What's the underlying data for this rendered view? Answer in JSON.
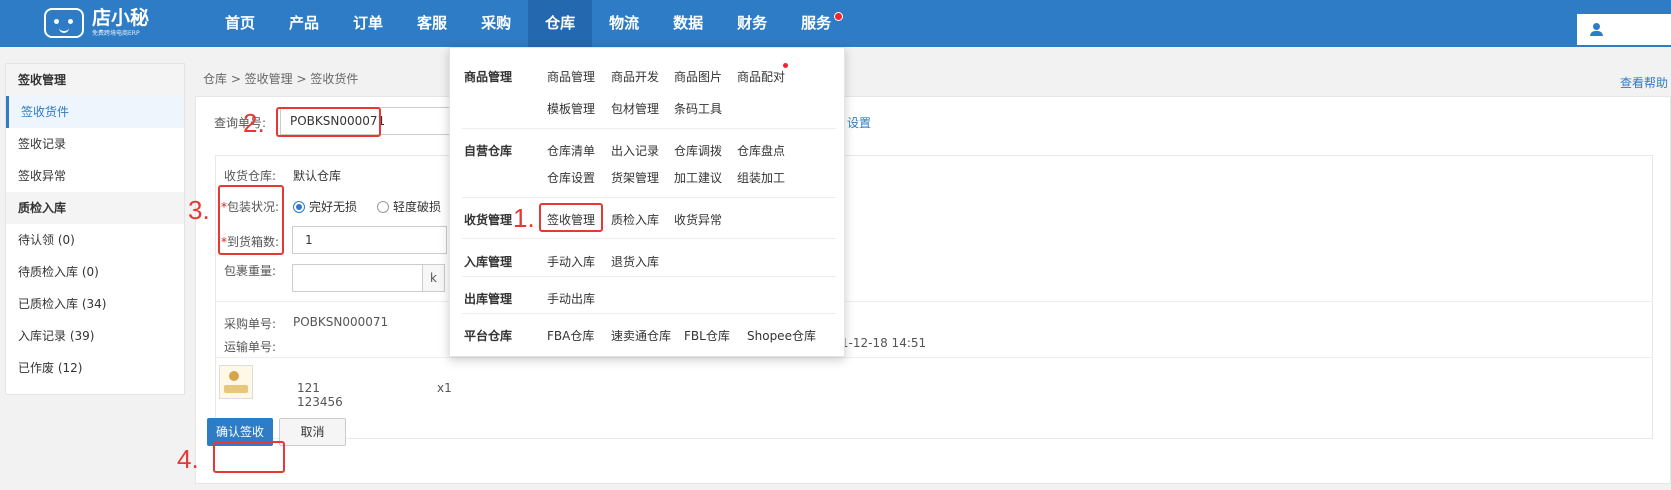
{
  "topbar": {
    "logo_name": "店小秘",
    "logo_sub": "免费跨境电商ERP",
    "nav": [
      "首页",
      "产品",
      "订单",
      "客服",
      "采购",
      "仓库",
      "物流",
      "数据",
      "财务",
      "服务"
    ],
    "active_nav": "仓库"
  },
  "sidebar": {
    "group1": "签收管理",
    "items1": [
      "签收货件",
      "签收记录",
      "签收异常"
    ],
    "group2": "质检入库",
    "items2": [
      "待认领 (0)",
      "待质检入库 (0)",
      "已质检入库 (34)",
      "入库记录 (39)",
      "已作废 (12)"
    ]
  },
  "breadcrumb": "仓库 > 签收管理 > 签收货件",
  "help_link": "查看帮助",
  "form": {
    "query_label": "查询单号:",
    "query_value": "POBKSN000071",
    "settings_link": "设置",
    "warehouse_label": "收货仓库:",
    "warehouse_value": "默认仓库",
    "package_label": "包装状况:",
    "package_opt1": "完好无损",
    "package_opt2": "轻度破损",
    "box_count_label": "到货箱数:",
    "box_count_value": "1",
    "weight_label": "包裹重量:",
    "weight_unit": "k",
    "po_label": "采购单号:",
    "po_value": "POBKSN000071",
    "shipping_label": "运输单号:",
    "datetime": "2021-12-18 14:51",
    "product_name": "121",
    "product_sku": "123456",
    "product_qty": "x1",
    "confirm_btn": "确认签收",
    "cancel_btn": "取消"
  },
  "dropdown": {
    "sections": [
      {
        "title": "商品管理",
        "rows": [
          [
            "商品管理",
            "商品开发",
            "商品图片",
            "商品配对"
          ],
          [
            "模板管理",
            "包材管理",
            "条码工具"
          ]
        ]
      },
      {
        "title": "自营仓库",
        "rows": [
          [
            "仓库清单",
            "出入记录",
            "仓库调拨",
            "仓库盘点"
          ],
          [
            "仓库设置",
            "货架管理",
            "加工建议",
            "组装加工"
          ]
        ]
      },
      {
        "title": "收货管理",
        "rows": [
          [
            "签收管理",
            "质检入库",
            "收货异常"
          ]
        ]
      },
      {
        "title": "入库管理",
        "rows": [
          [
            "手动入库",
            "退货入库"
          ]
        ]
      },
      {
        "title": "出库管理",
        "rows": [
          [
            "手动出库"
          ]
        ]
      },
      {
        "title": "平台仓库",
        "rows": [
          [
            "FBA仓库",
            "速卖通仓库",
            "FBL仓库",
            "Shopee仓库"
          ]
        ]
      }
    ]
  },
  "annotations": [
    "1.",
    "2.",
    "3.",
    "4."
  ],
  "colors": {
    "brand": "#2e7bc6",
    "annotation": "#e53935"
  }
}
